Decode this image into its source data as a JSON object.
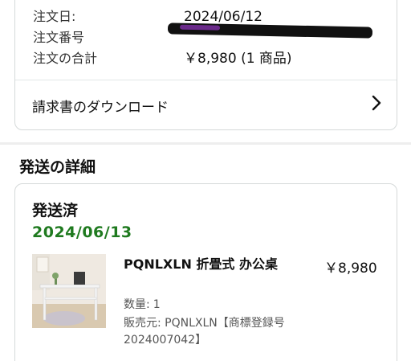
{
  "order_summary": {
    "order_date_label": "注文日:",
    "order_date_value": "2024/06/12",
    "order_number_label": "注文番号",
    "order_total_label": "注文の合計",
    "order_total_value": "￥8,980 (1 商品)",
    "invoice_link_label": "請求書のダウンロード"
  },
  "shipping": {
    "section_title": "発送の詳細",
    "status": "発送済",
    "date": "2024/06/13",
    "item": {
      "name": "PQNLXLN 折畳式 办公桌",
      "price": "￥8,980",
      "quantity_label": "数量:",
      "quantity_value": "1",
      "seller": "販売元: PQNLXLN【商標登録号 2024007042】"
    }
  },
  "colors": {
    "shipped_date": "#1f7a1f",
    "redaction": "#111111"
  }
}
